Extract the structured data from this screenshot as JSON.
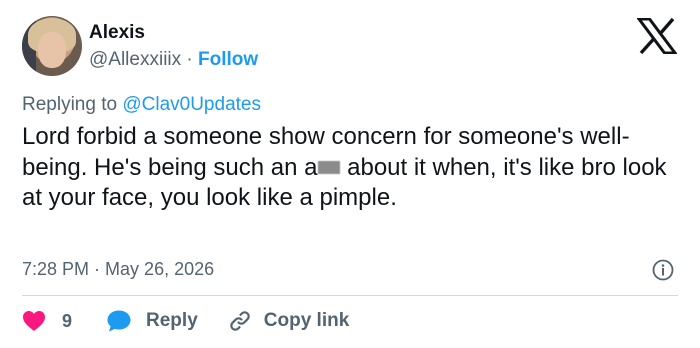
{
  "author": {
    "name": "Alexis",
    "handle": "@Allexxiiix",
    "separator": " · ",
    "follow_label": "Follow",
    "avatar_icon": "profile-photo"
  },
  "reply_context": {
    "prefix": "Replying to ",
    "target": "@Clav0Updates"
  },
  "tweet": {
    "text_before_censor": "Lord forbid a someone show concern for someone's well-being. He's being such an a",
    "text_after_censor": " about it when, it's like bro look at your face, you look like a pimple."
  },
  "meta": {
    "time": "7:28 PM",
    "separator": " · ",
    "date": "May 26, 2026"
  },
  "actions": {
    "like_count": "9",
    "reply_label": "Reply",
    "copy_label": "Copy link"
  },
  "colors": {
    "accent": "#1d9bf0",
    "like": "#f91880",
    "muted": "#536471",
    "text": "#0f1419"
  },
  "icons": [
    "x-logo-icon",
    "info-icon",
    "heart-icon",
    "speech-bubble-icon",
    "link-icon"
  ]
}
